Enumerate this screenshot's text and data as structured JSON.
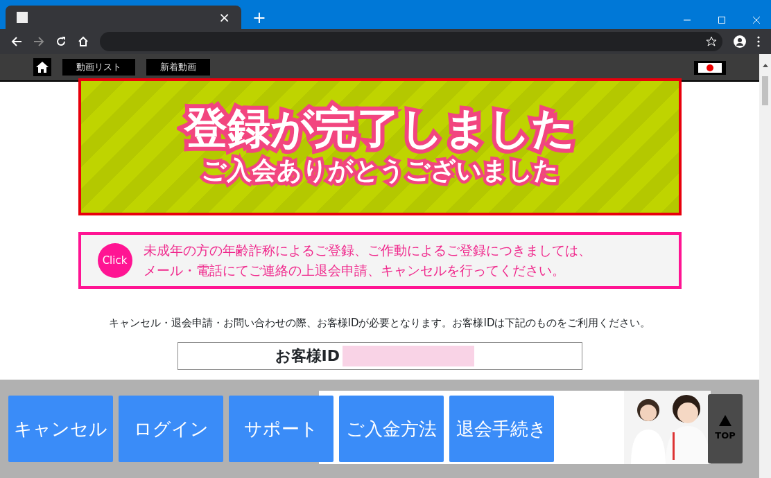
{
  "browser": {
    "tab_close": "×",
    "new_tab": "+"
  },
  "site_nav": {
    "items": [
      {
        "kind": "home"
      },
      {
        "kind": "link",
        "label": "動画リスト"
      },
      {
        "kind": "link",
        "label": "新着動画"
      }
    ]
  },
  "banner": {
    "title": "登録が完了しました",
    "subtitle": "ご入会ありがとうございました"
  },
  "notice": {
    "icon_label": "Click",
    "lines": [
      "未成年の方の年齢詐称によるご登録、ご作動によるご登録につきましては、",
      "メール・電話にてご連絡の上退会申請、キャンセルを行ってください。"
    ]
  },
  "info_text": "キャンセル・退会申請・お問い合わせの際、お客様IDが必要となります。お客様IDは下記のものをご利用ください。",
  "customer_id": {
    "label": "お客様ID"
  },
  "footer_menu": {
    "buttons": [
      "キャンセル",
      "ログイン",
      "サポート",
      "ご入金方法",
      "退会手続き"
    ],
    "top_button": "TOP"
  }
}
